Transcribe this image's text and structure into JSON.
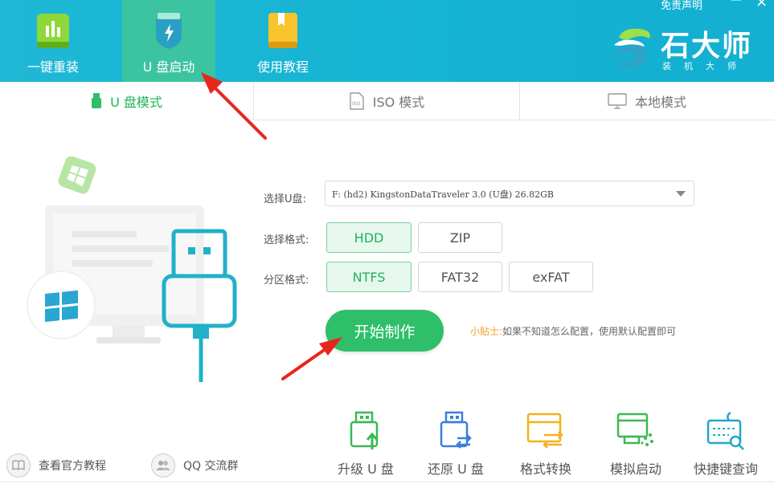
{
  "window": {
    "disclaimer": "免责声明",
    "minimize": "—",
    "close": "×"
  },
  "nav": {
    "items": [
      {
        "label": "一键重装",
        "icon": "chart-bar-icon"
      },
      {
        "label": "U 盘启动",
        "icon": "usb-shield-icon",
        "active": true
      },
      {
        "label": "使用教程",
        "icon": "book-icon"
      }
    ]
  },
  "logo": {
    "name": "石大师",
    "sub": "装机大师"
  },
  "tabs": [
    {
      "label": "U 盘模式",
      "icon": "usb-icon",
      "active": true
    },
    {
      "label": "ISO 模式",
      "icon": "iso-file-icon"
    },
    {
      "label": "本地模式",
      "icon": "monitor-icon"
    }
  ],
  "form": {
    "usb_label": "选择U盘:",
    "usb_value": "F: (hd2) KingstonDataTraveler 3.0 (U盘) 26.82GB",
    "format_label": "选择格式:",
    "format_options": [
      "HDD",
      "ZIP"
    ],
    "format_selected": "HDD",
    "partition_label": "分区格式:",
    "partition_options": [
      "NTFS",
      "FAT32",
      "exFAT"
    ],
    "partition_selected": "NTFS",
    "start_button": "开始制作",
    "tip_key": "小贴士:",
    "tip_text": "如果不知道怎么配置，使用默认配置即可"
  },
  "bottom_links": [
    {
      "label": "查看官方教程",
      "icon": "book-open-icon"
    },
    {
      "label": "QQ 交流群",
      "icon": "users-icon"
    }
  ],
  "tools": [
    {
      "label": "升级 U 盘",
      "icon": "usb-upgrade-icon"
    },
    {
      "label": "还原 U 盘",
      "icon": "usb-restore-icon"
    },
    {
      "label": "格式转换",
      "icon": "format-convert-icon"
    },
    {
      "label": "模拟启动",
      "icon": "simulate-boot-icon"
    },
    {
      "label": "快捷键查询",
      "icon": "keyboard-search-icon"
    }
  ],
  "colors": {
    "header": "#17b4d4",
    "accent_green": "#2fbf6a",
    "active_tab": "#3cc3a0",
    "tip": "#f0a020"
  }
}
